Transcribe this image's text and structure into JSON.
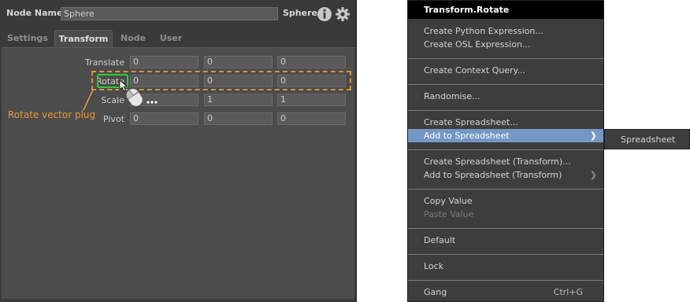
{
  "node": {
    "name_label": "Node Name",
    "name_value": "Sphere",
    "type_label": "Sphere",
    "icons": [
      "info-icon",
      "gear-icon"
    ]
  },
  "tabs": [
    {
      "label": "Settings",
      "active": false
    },
    {
      "label": "Transform",
      "active": true
    },
    {
      "label": "Node",
      "active": false
    },
    {
      "label": "User",
      "active": false
    }
  ],
  "plugs": [
    {
      "label": "Translate",
      "values": [
        "0",
        "0",
        "0"
      ]
    },
    {
      "label": "Rotate",
      "values": [
        "0",
        "0",
        "0"
      ]
    },
    {
      "label": "Scale",
      "values": [
        "1",
        "1",
        "1"
      ]
    },
    {
      "label": "Pivot",
      "values": [
        "0",
        "0",
        "0"
      ]
    }
  ],
  "annotation": {
    "label": "Rotate vector plug",
    "color": "#e89a3a",
    "highlight_color": "#2bd12b"
  },
  "menu": {
    "title": "Transform.Rotate",
    "items": {
      "python": "Create Python Expression...",
      "osl": "Create OSL Expression...",
      "context_query": "Create Context Query...",
      "randomise": "Randomise...",
      "create_spreadsheet": "Create Spreadsheet...",
      "add_spreadsheet": "Add to Spreadsheet",
      "create_spreadsheet_transform": "Create Spreadsheet (Transform)...",
      "add_spreadsheet_transform": "Add to Spreadsheet (Transform)",
      "copy_value": "Copy Value",
      "paste_value": "Paste Value",
      "default": "Default",
      "lock": "Lock",
      "gang": "Gang",
      "gang_shortcut": "Ctrl+G"
    },
    "highlight_color": "#7497c4"
  },
  "submenu": {
    "items": [
      "Spreadsheet"
    ]
  }
}
